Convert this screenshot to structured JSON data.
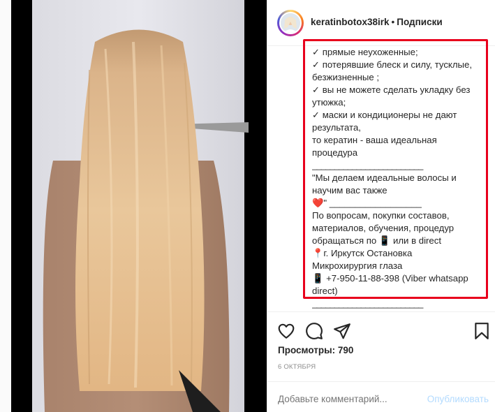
{
  "header": {
    "username": "keratinbotox38irk",
    "separator": "•",
    "follow_label": "Подписки"
  },
  "caption": {
    "lines": [
      "✓ прямые неухоженные;",
      "✓ потерявшие блеск и силу, тусклые,",
      "безжизненные ;",
      "✓ вы не можете сделать укладку без",
      "утюжка;",
      "✓ маски и кондиционеры не дают",
      "результата,",
      "то кератин - ваша идеальная",
      "процедура",
      "_________________________",
      "\"Мы делаем идеальные волосы и",
      "научим вас также",
      "❤️\" __________________",
      "По вопросам, покупки составов,",
      "материалов, обучения, процедур",
      "обращаться по 📱 или в direct",
      "📍г. Иркутск Остановка",
      "Микрохирургия глаза",
      "📱 +7-950-11-88-398 (Viber whatsapp",
      "direct)",
      "_________________________"
    ]
  },
  "stats": {
    "views": "Просмотры: 790",
    "date": "6 ОКТЯБРЯ"
  },
  "comment": {
    "placeholder": "Добавьте комментарий...",
    "publish_label": "Опубликовать"
  },
  "colors": {
    "highlight": "#e8001c",
    "publish_disabled": "#b3dbff",
    "text": "#262626",
    "muted": "#8e8e8e"
  },
  "icons": [
    "heart-icon",
    "comment-icon",
    "share-icon",
    "bookmark-icon"
  ]
}
